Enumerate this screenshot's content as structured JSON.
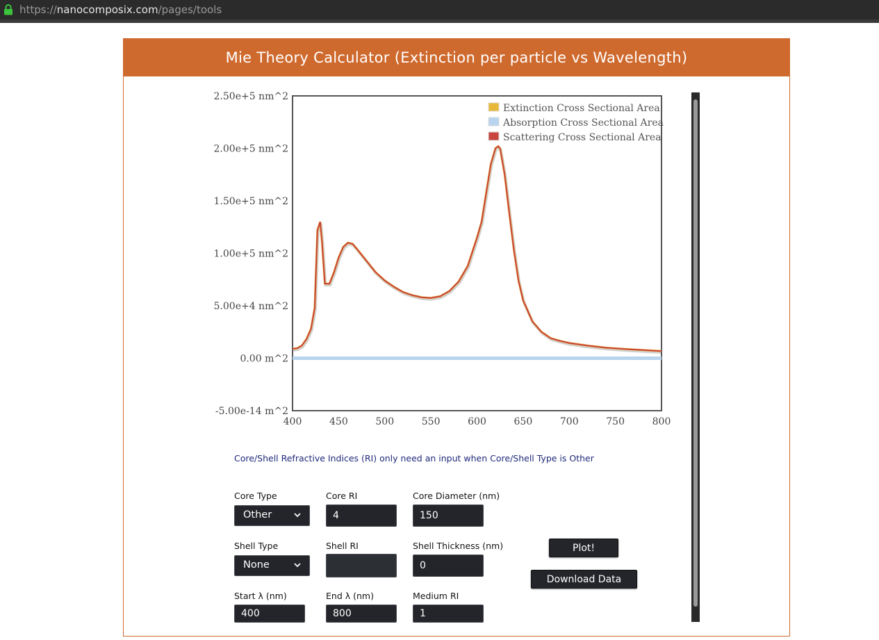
{
  "browser": {
    "url_scheme": "https://",
    "url_host": "nanocomposix.com",
    "url_path": "/pages/tools"
  },
  "panel": {
    "title": "Mie Theory Calculator (Extinction per particle vs Wavelength)"
  },
  "chart_data": {
    "type": "line",
    "title": "",
    "xlabel": "",
    "ylabel": "",
    "xlim": [
      400,
      800
    ],
    "ylim": [
      -5e-14,
      250000
    ],
    "x_ticks": [
      "400",
      "450",
      "500",
      "550",
      "600",
      "650",
      "700",
      "750",
      "800"
    ],
    "y_ticks": [
      "2.50e+5 nm^2",
      "2.00e+5 nm^2",
      "1.50e+5 nm^2",
      "1.00e+5 nm^2",
      "5.00e+4 nm^2",
      "0.00 m^2",
      "-5.00e-14 m^2"
    ],
    "grid": true,
    "legend_position": "top-right",
    "series": [
      {
        "name": "Extinction Cross Sectional Area",
        "color": "#e8b838",
        "x": [
          400,
          405,
          410,
          415,
          420,
          424,
          427,
          430,
          432,
          435,
          440,
          445,
          450,
          455,
          460,
          465,
          470,
          480,
          490,
          500,
          510,
          520,
          530,
          540,
          550,
          560,
          570,
          580,
          590,
          600,
          605,
          610,
          615,
          620,
          623,
          625,
          630,
          635,
          640,
          645,
          650,
          660,
          670,
          680,
          690,
          700,
          720,
          740,
          760,
          780,
          800
        ],
        "y": [
          9000,
          9500,
          12000,
          18000,
          28000,
          48000,
          122000,
          130000,
          110000,
          71000,
          71000,
          82000,
          96000,
          106000,
          110000,
          109000,
          104000,
          93000,
          82000,
          74000,
          68000,
          63000,
          60000,
          58000,
          57500,
          59000,
          64000,
          73000,
          88000,
          115000,
          130000,
          158000,
          185000,
          200000,
          202000,
          200000,
          175000,
          138000,
          103000,
          74000,
          55000,
          35000,
          25000,
          19000,
          16500,
          14500,
          12000,
          10000,
          8800,
          7800,
          6800
        ]
      },
      {
        "name": "Absorption Cross Sectional Area",
        "color": "#b8d4ee",
        "x": [
          400,
          800
        ],
        "y": [
          0,
          0
        ]
      },
      {
        "name": "Scattering Cross Sectional Area",
        "color": "#c8443e",
        "x": [
          400,
          405,
          410,
          415,
          420,
          424,
          427,
          430,
          432,
          435,
          440,
          445,
          450,
          455,
          460,
          465,
          470,
          480,
          490,
          500,
          510,
          520,
          530,
          540,
          550,
          560,
          570,
          580,
          590,
          600,
          605,
          610,
          615,
          620,
          623,
          625,
          630,
          635,
          640,
          645,
          650,
          660,
          670,
          680,
          690,
          700,
          720,
          740,
          760,
          780,
          800
        ],
        "y": [
          9000,
          9500,
          12000,
          18000,
          28000,
          48000,
          122000,
          130000,
          110000,
          71000,
          71000,
          82000,
          96000,
          106000,
          110000,
          109000,
          104000,
          93000,
          82000,
          74000,
          68000,
          63000,
          60000,
          58000,
          57500,
          59000,
          64000,
          73000,
          88000,
          115000,
          130000,
          158000,
          185000,
          200000,
          202000,
          200000,
          175000,
          138000,
          103000,
          74000,
          55000,
          35000,
          25000,
          19000,
          16500,
          14500,
          12000,
          10000,
          8800,
          7800,
          6800
        ]
      }
    ]
  },
  "form": {
    "note": "Core/Shell Refractive Indices (RI) only need an input when Core/Shell Type is Other",
    "core_type_label": "Core Type",
    "core_type_value": "Other",
    "core_ri_label": "Core RI",
    "core_ri_value": "4",
    "core_diameter_label": "Core Diameter (nm)",
    "core_diameter_value": "150",
    "shell_type_label": "Shell Type",
    "shell_type_value": "None",
    "shell_ri_label": "Shell RI",
    "shell_ri_value": "",
    "shell_thickness_label": "Shell Thickness (nm)",
    "shell_thickness_value": "0",
    "start_label": "Start λ (nm)",
    "start_value": "400",
    "end_label": "End λ (nm)",
    "end_value": "800",
    "medium_ri_label": "Medium RI",
    "medium_ri_value": "1",
    "plot_button": "Plot!",
    "download_button": "Download Data"
  }
}
